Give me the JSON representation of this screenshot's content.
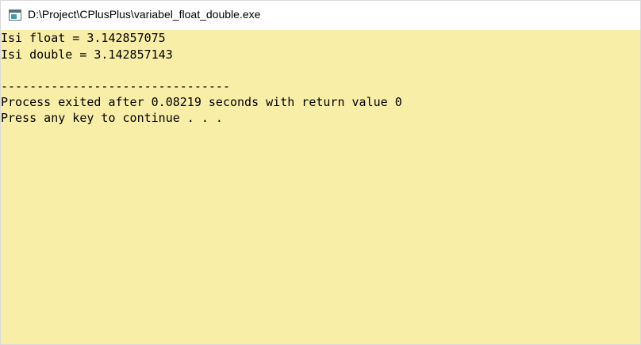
{
  "window": {
    "title": "D:\\Project\\CPlusPlus\\variabel_float_double.exe",
    "icon": "console-window-icon"
  },
  "console": {
    "background_color": "#f8eea8",
    "lines": [
      "Isi float = 3.142857075",
      "Isi double = 3.142857143",
      "",
      "--------------------------------",
      "Process exited after 0.08219 seconds with return value 0",
      "Press any key to continue . . ."
    ]
  }
}
